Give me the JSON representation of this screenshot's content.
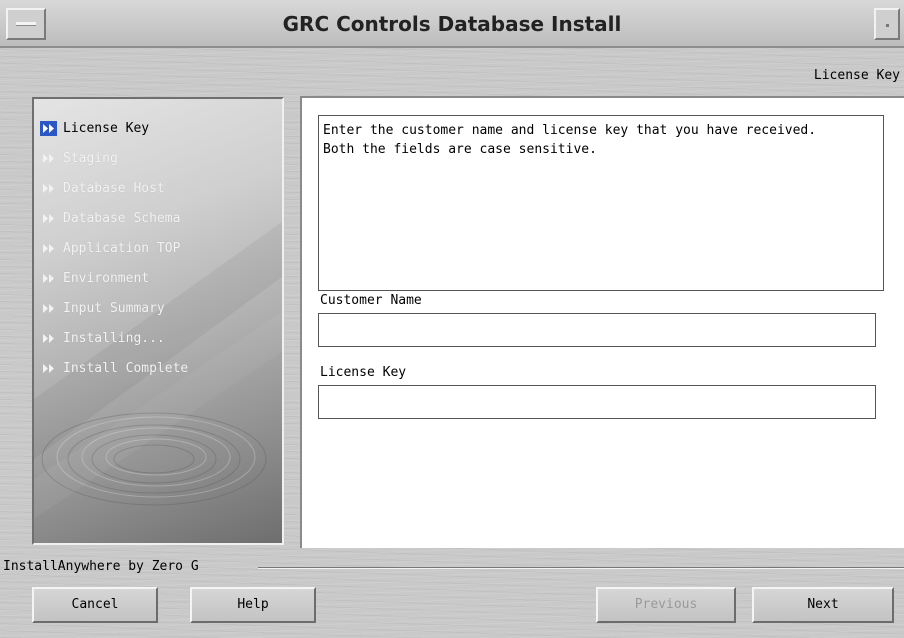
{
  "window": {
    "title": "GRC Controls Database Install"
  },
  "header": {
    "step_heading": "License Key"
  },
  "sidebar": {
    "steps": [
      {
        "label": "License Key",
        "state": "active"
      },
      {
        "label": "Staging",
        "state": "inactive"
      },
      {
        "label": "Database Host",
        "state": "inactive"
      },
      {
        "label": "Database Schema",
        "state": "inactive"
      },
      {
        "label": "Application TOP",
        "state": "inactive"
      },
      {
        "label": "Environment",
        "state": "inactive"
      },
      {
        "label": "Input Summary",
        "state": "inactive"
      },
      {
        "label": "Installing...",
        "state": "inactive"
      },
      {
        "label": "Install Complete",
        "state": "inactive"
      }
    ]
  },
  "main": {
    "instructions": "Enter the customer name and license key that you have received.\nBoth the fields are case sensitive.",
    "customer_name": {
      "label": "Customer Name",
      "value": ""
    },
    "license_key": {
      "label": "License Key",
      "value": ""
    }
  },
  "footer": {
    "vendor": "InstallAnywhere by Zero G",
    "cancel_label": "Cancel",
    "help_label": "Help",
    "previous_label": "Previous",
    "next_label": "Next"
  },
  "colors": {
    "active_icon": "#2a56c6",
    "inactive_icon": "#f2f2f2"
  },
  "icons": {
    "step": "fast-forward-icon",
    "window_menu": "window-menu-icon",
    "minimize": "minimize-icon"
  }
}
